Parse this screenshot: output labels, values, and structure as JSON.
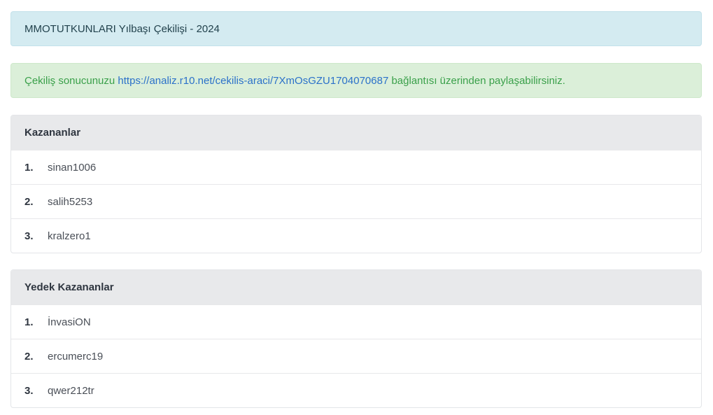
{
  "title": "MMOTUTKUNLARI Yılbaşı Çekilişi - 2024",
  "result": {
    "prefix": "Çekiliş sonucunuzu",
    "link": "https://analiz.r10.net/cekilis-araci/7XmOsGZU1704070687",
    "suffix": "bağlantısı üzerinden paylaşabilirsiniz."
  },
  "winners": {
    "heading": "Kazananlar",
    "items": [
      {
        "num": "1.",
        "name": "sinan1006"
      },
      {
        "num": "2.",
        "name": "salih5253"
      },
      {
        "num": "3.",
        "name": "kralzero1"
      }
    ]
  },
  "backup": {
    "heading": "Yedek Kazananlar",
    "items": [
      {
        "num": "1.",
        "name": "İnvasiON"
      },
      {
        "num": "2.",
        "name": "ercumerc19"
      },
      {
        "num": "3.",
        "name": "qwer212tr"
      }
    ]
  }
}
